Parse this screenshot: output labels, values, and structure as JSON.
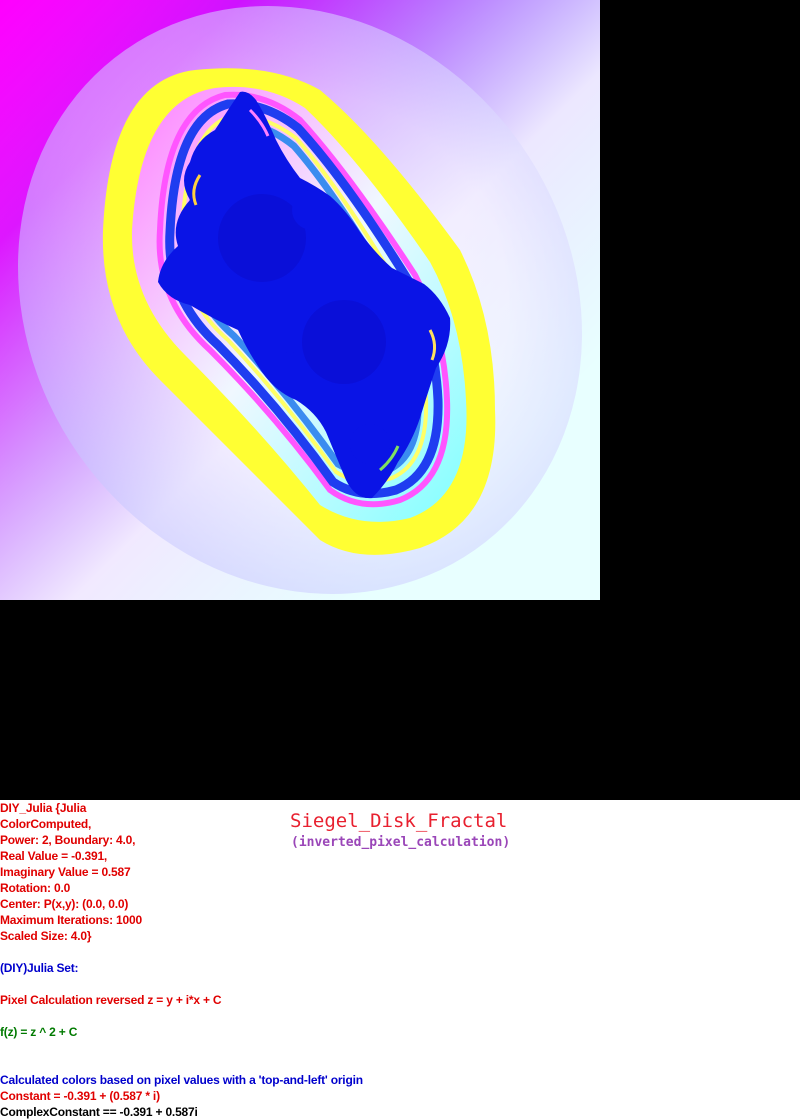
{
  "colors": {
    "background": "#000000",
    "panel": "#ffffff",
    "red_text": "#e00000",
    "blue_text": "#0000cc",
    "green_text": "#007a00",
    "title": "#e8202f",
    "subtitle": "#9a46b8",
    "fractal_fill": "#0a14e6",
    "band_yellow": "#ffff33",
    "corner_magenta": "#ff00ff",
    "corner_blue": "#0000ff",
    "corner_cyan": "#00ffff"
  },
  "title": "Siegel_Disk_Fractal",
  "subtitle": "(inverted_pixel_calculation)",
  "params": [
    "DIY_Julia {Julia",
    "ColorComputed,",
    "Power: 2, Boundary: 4.0,",
    "Real Value = -0.391,",
    "Imaginary Value = 0.587",
    "Rotation: 0.0",
    "Center: P(x,y): (0.0, 0.0)",
    "Maximum Iterations: 1000",
    "Scaled Size: 4.0}"
  ],
  "set_name": "(DIY)Julia Set:",
  "pixel_calc": "Pixel Calculation reversed z = y + i*x + C",
  "formula": "f(z) = z ^ 2 + C",
  "colors_note": "Calculated colors based on pixel values with a 'top-and-left' origin",
  "constant": "Constant = -0.391 + (0.587 * i)",
  "complex_constant": "ComplexConstant == -0.391 + 0.587i"
}
